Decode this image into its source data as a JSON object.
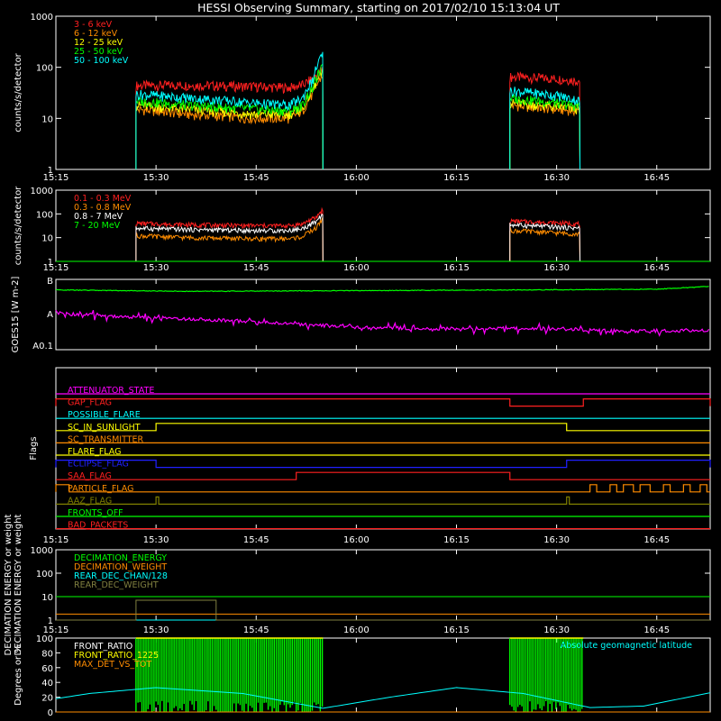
{
  "title": "HESSI Observing Summary, starting on 2017/02/10 15:13:04 UT",
  "time_axis": {
    "start_min": 15.0,
    "end_min": 113.0,
    "ticks": [
      {
        "t": 15,
        "label": "15:15"
      },
      {
        "t": 30,
        "label": "15:30"
      },
      {
        "t": 45,
        "label": "15:45"
      },
      {
        "t": 60,
        "label": "16:00"
      },
      {
        "t": 75,
        "label": "16:15"
      },
      {
        "t": 90,
        "label": "16:30"
      },
      {
        "t": 105,
        "label": "16:45"
      }
    ]
  },
  "chart_data": [
    {
      "type": "line",
      "ylabel": "counts/s/detector",
      "scale": "log",
      "ylim": [
        1,
        1000
      ],
      "ytick_labels": [
        "1",
        "10",
        "100",
        "1000"
      ],
      "legend_position": "top-left",
      "series": [
        {
          "name": "3 - 6 keV",
          "color": "#ff2020",
          "segments": [
            {
              "x": [
                27,
                35,
                45,
                50,
                52,
                53.5,
                55
              ],
              "y": [
                44,
                45,
                42,
                40,
                45,
                60,
                90
              ]
            },
            {
              "x": [
                83,
                90,
                93.5
              ],
              "y": [
                65,
                60,
                55
              ]
            }
          ]
        },
        {
          "name": "6 - 12 keV",
          "color": "#ff8c00",
          "segments": [
            {
              "x": [
                27,
                35,
                45,
                50,
                52,
                53.5,
                55
              ],
              "y": [
                15,
                12,
                10,
                10,
                14,
                30,
                70
              ]
            },
            {
              "x": [
                83,
                90,
                93.5
              ],
              "y": [
                18,
                15,
                14
              ]
            }
          ]
        },
        {
          "name": "12 - 25 keV",
          "color": "#ffff00",
          "segments": [
            {
              "x": [
                27,
                35,
                45,
                50,
                52,
                53.5,
                55
              ],
              "y": [
                18,
                15,
                12,
                12,
                16,
                35,
                80
              ]
            },
            {
              "x": [
                83,
                90,
                93.5
              ],
              "y": [
                20,
                17,
                15
              ]
            }
          ]
        },
        {
          "name": "25 - 50 keV",
          "color": "#00ff00",
          "segments": [
            {
              "x": [
                27,
                35,
                45,
                50,
                52,
                53.5,
                55
              ],
              "y": [
                22,
                18,
                15,
                14,
                18,
                40,
                100
              ]
            },
            {
              "x": [
                83,
                90,
                93.5
              ],
              "y": [
                25,
                20,
                17
              ]
            }
          ]
        },
        {
          "name": "50 - 100 keV",
          "color": "#00ffff",
          "segments": [
            {
              "x": [
                27,
                35,
                45,
                50,
                52,
                53.5,
                55
              ],
              "y": [
                30,
                25,
                20,
                18,
                25,
                55,
                180
              ]
            },
            {
              "x": [
                83,
                90,
                93.5
              ],
              "y": [
                35,
                28,
                22
              ]
            }
          ]
        }
      ]
    },
    {
      "type": "line",
      "ylabel": "counts/s/detector",
      "scale": "log",
      "ylim": [
        1,
        1000
      ],
      "ytick_labels": [
        "1",
        "10",
        "100",
        "1000"
      ],
      "legend_position": "top-left",
      "series": [
        {
          "name": "0.1 - 0.3 MeV",
          "color": "#ff2020",
          "segments": [
            {
              "x": [
                27,
                35,
                45,
                50,
                52,
                54,
                55
              ],
              "y": [
                40,
                35,
                32,
                32,
                38,
                70,
                150
              ]
            },
            {
              "x": [
                83,
                90,
                93.5
              ],
              "y": [
                50,
                42,
                38
              ]
            }
          ]
        },
        {
          "name": "0.3 - 0.8 MeV",
          "color": "#ff8c00",
          "segments": [
            {
              "x": [
                27,
                35,
                45,
                50,
                52,
                54,
                55
              ],
              "y": [
                12,
                10,
                9,
                9,
                11,
                25,
                60
              ]
            },
            {
              "x": [
                83,
                90,
                93.5
              ],
              "y": [
                20,
                16,
                14
              ]
            }
          ]
        },
        {
          "name": "0.8 - 7 MeV",
          "color": "#ffffff",
          "segments": [
            {
              "x": [
                27,
                35,
                45,
                50,
                52,
                54,
                55
              ],
              "y": [
                25,
                22,
                20,
                20,
                24,
                45,
                100
              ]
            },
            {
              "x": [
                83,
                90,
                93.5
              ],
              "y": [
                35,
                28,
                25
              ]
            }
          ]
        },
        {
          "name": "7 - 20 MeV",
          "color": "#00ff00",
          "segments": [
            {
              "x": [
                15,
                113
              ],
              "y": [
                1,
                1
              ]
            }
          ]
        }
      ]
    },
    {
      "type": "line",
      "ylabel": "GOES15 [W m-2]",
      "ytick_labels": [
        "B",
        "A",
        "A0.1"
      ],
      "series": [
        {
          "name": "",
          "color": "#00ff00",
          "segments": [
            {
              "x": [
                15,
                35,
                60,
                85,
                105,
                113
              ],
              "y": [
                0.85,
                0.83,
                0.84,
                0.85,
                0.86,
                0.9
              ]
            }
          ]
        },
        {
          "name": "",
          "color": "#ff00ff",
          "segments": [
            {
              "x": [
                15,
                25,
                40,
                50,
                60,
                70,
                80,
                90,
                100,
                113
              ],
              "y": [
                0.52,
                0.47,
                0.42,
                0.37,
                0.32,
                0.3,
                0.3,
                0.3,
                0.26,
                0.28
              ]
            }
          ]
        }
      ]
    },
    {
      "type": "line",
      "ylabel": "Flags",
      "flags": [
        {
          "name": "ATTENUATOR_STATE",
          "color": "#ff00ff",
          "highs": []
        },
        {
          "name": "GAP_FLAG",
          "color": "#ff2020",
          "highs": [
            [
              15,
              83
            ],
            [
              94,
              113
            ]
          ]
        },
        {
          "name": "POSSIBLE_FLARE",
          "color": "#00ffff",
          "highs": []
        },
        {
          "name": "SC_IN_SUNLIGHT",
          "color": "#ffff00",
          "highs": [
            [
              30,
              91.5
            ]
          ]
        },
        {
          "name": "SC_TRANSMITTER",
          "color": "#ff8c00",
          "highs": []
        },
        {
          "name": "FLARE_FLAG",
          "color": "#ffff00",
          "highs": []
        },
        {
          "name": "ECLIPSE_FLAG",
          "color": "#2020ff",
          "highs": [
            [
              15,
              30
            ],
            [
              91.5,
              113
            ]
          ]
        },
        {
          "name": "SAA_FLAG",
          "color": "#ff2020",
          "highs": [
            [
              51,
              83
            ]
          ]
        },
        {
          "name": "PARTICLE_FLAG",
          "color": "#ff8c00",
          "highs": [
            [
              15,
              17
            ],
            [
              95,
              96
            ],
            [
              98,
              99
            ],
            [
              100,
              101.5
            ],
            [
              102.5,
              104
            ],
            [
              106,
              107
            ],
            [
              109,
              110
            ],
            [
              111.5,
              112.5
            ]
          ]
        },
        {
          "name": "AAZ_FLAG",
          "color": "#808000",
          "highs": [
            [
              30,
              30.4
            ],
            [
              91.5,
              91.9
            ]
          ]
        },
        {
          "name": "FRONTS_OFF",
          "color": "#00ff00",
          "highs": []
        },
        {
          "name": "BAD_PACKETS",
          "color": "#ff2020",
          "highs": []
        }
      ]
    },
    {
      "type": "line",
      "ylabel": "DECIMATION ENERGY or weight",
      "scale": "log",
      "ylim": [
        1,
        1000
      ],
      "ytick_labels": [
        "1",
        "10",
        "100",
        "1000"
      ],
      "legend_position": "top-left",
      "series": [
        {
          "name": "DECIMATION_ENERGY",
          "color": "#00ff00",
          "segments": [
            {
              "x": [
                15,
                113
              ],
              "y": [
                10,
                10
              ]
            }
          ]
        },
        {
          "name": "DECIMATION_WEIGHT",
          "color": "#ff8c00",
          "segments": [
            {
              "x": [
                15,
                113
              ],
              "y": [
                1.8,
                1.8
              ]
            }
          ]
        },
        {
          "name": "REAR_DEC_CHAN/128",
          "color": "#00ffff",
          "segments": [
            {
              "x": [
                15,
                113
              ],
              "y": [
                1,
                1
              ]
            }
          ]
        },
        {
          "name": "REAR_DEC_WEIGHT",
          "color": "#808040",
          "segments": [
            {
              "x": [
                15,
                27,
                27,
                39,
                39,
                113
              ],
              "y": [
                1,
                1,
                7,
                7,
                1,
                1
              ]
            }
          ]
        }
      ]
    },
    {
      "type": "line",
      "ylabel": "Degrees or %",
      "ylim": [
        0,
        100
      ],
      "ytick_labels": [
        "0",
        "20",
        "40",
        "60",
        "80",
        "100"
      ],
      "legend_position": "top-left",
      "annotation": "Absolute geomagnetic latitude",
      "series": [
        {
          "name": "FRONT_RATIO",
          "color": "#ffffff",
          "segments": []
        },
        {
          "name": "FRONT_RATIO_1225",
          "color": "#ffff00",
          "segments": []
        },
        {
          "name": "MAX_DET_VS_TOT",
          "color": "#ff8c00",
          "segments": [
            {
              "x": [
                15,
                113
              ],
              "y": [
                0,
                0
              ]
            }
          ]
        },
        {
          "name": "",
          "color": "#00ffff",
          "segments": [
            {
              "x": [
                15,
                20,
                30,
                43,
                55,
                65,
                75,
                85,
                95,
                103,
                113
              ],
              "y": [
                18,
                25,
                33,
                25,
                5,
                20,
                33,
                25,
                6,
                8,
                26
              ]
            }
          ]
        }
      ],
      "fill_regions": [
        {
          "color": "#00ff00",
          "range": [
            27,
            55
          ],
          "y": [
            0,
            100
          ]
        },
        {
          "color": "#00ff00",
          "range": [
            83,
            94
          ],
          "y": [
            0,
            100
          ]
        }
      ]
    }
  ]
}
